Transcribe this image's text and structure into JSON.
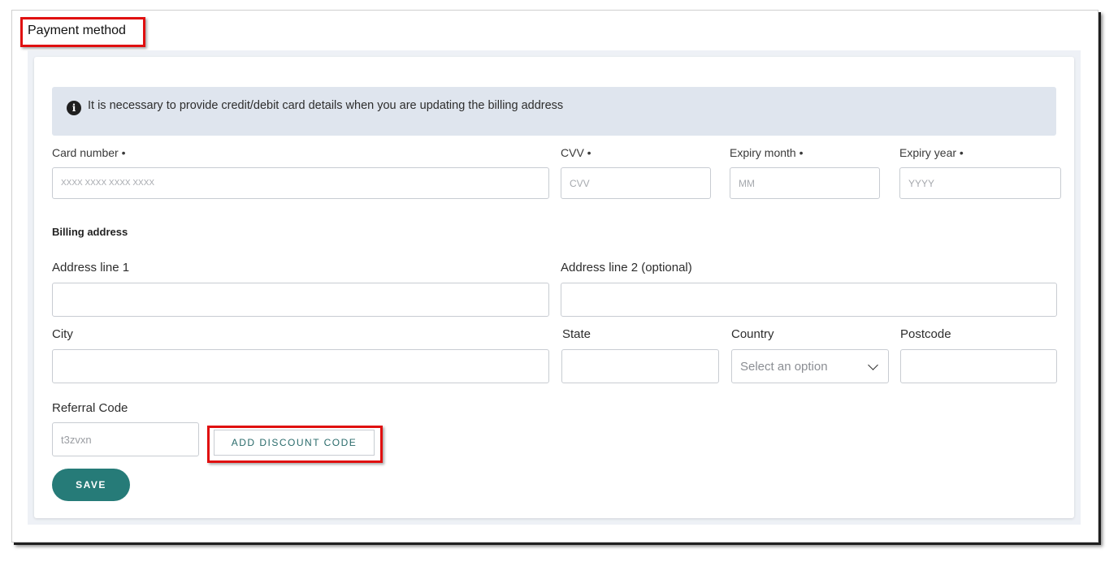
{
  "section": {
    "title": "Payment method"
  },
  "info": {
    "text": "It is necessary to provide credit/debit card details when you are updating the billing address",
    "icon": "info-icon"
  },
  "card": {
    "number_label": "Card number •",
    "number_placeholder": "XXXX XXXX XXXX XXXX",
    "cvv_label": "CVV •",
    "cvv_placeholder": "CVV",
    "month_label": "Expiry month •",
    "month_placeholder": "MM",
    "year_label": "Expiry year •",
    "year_placeholder": "YYYY"
  },
  "billing": {
    "heading": "Billing address",
    "address1_label": "Address line 1",
    "address1_value": "",
    "address2_label": "Address line 2 (optional)",
    "address2_value": "",
    "city_label": "City",
    "city_value": "",
    "state_label": "State",
    "state_value": "",
    "country_label": "Country",
    "country_selected": "Select an option",
    "postcode_label": "Postcode",
    "postcode_value": ""
  },
  "referral": {
    "label": "Referral Code",
    "value": "t3zvxn",
    "discount_button": "ADD DISCOUNT CODE"
  },
  "actions": {
    "save": "SAVE"
  },
  "colors": {
    "accent": "#267b78",
    "highlight": "#e01010",
    "info_bg": "#dfe5ee"
  }
}
